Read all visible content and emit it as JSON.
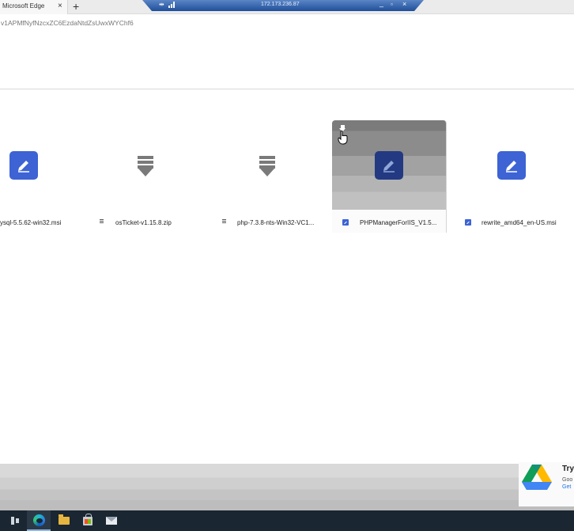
{
  "browser": {
    "tab_title": "Microsoft Edge",
    "tab_close": "×",
    "new_tab": "+",
    "url_fragment": "v1APMfNyfNzcxZC6EzdaNtdZsUwxWYChf6"
  },
  "remote_bar": {
    "host": "172.173.236.87",
    "pin_icon": "pin-icon",
    "signal_icon": "signal-icon",
    "minimize": "_",
    "restore": "▫",
    "close": "×"
  },
  "files": [
    {
      "name": "ysql-5.5.62-win32.msi",
      "icon": "file-edit-icon",
      "type": "installer"
    },
    {
      "name": "osTicket-v1.15.8.zip",
      "icon": "download-icon",
      "type": "archive"
    },
    {
      "name": "php-7.3.8-nts-Win32-VC1...",
      "icon": "download-icon",
      "type": "archive"
    },
    {
      "name": "PHPManagerForIIS_V1.5...",
      "icon": "file-edit-icon",
      "type": "installer",
      "hovered": true
    },
    {
      "name": "rewrite_amd64_en-US.msi",
      "icon": "file-edit-icon",
      "type": "installer"
    }
  ],
  "promo": {
    "title": "Try",
    "line1": "Goo",
    "line2": "Get"
  },
  "taskbar": {
    "items": [
      "task-view-icon",
      "edge-icon",
      "file-explorer-icon",
      "store-icon",
      "mail-icon"
    ]
  },
  "colors": {
    "accent": "#3d63d4",
    "taskbar": "#1a2631"
  }
}
